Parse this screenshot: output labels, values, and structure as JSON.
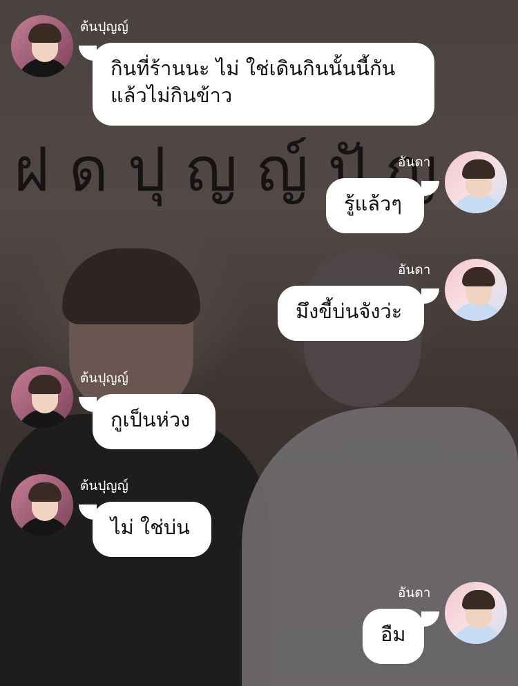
{
  "chat": {
    "sender_left": "ต้นปุญญ์",
    "sender_right": "อันดา",
    "banner_text": "ฝดปุญญ์ปัญ",
    "messages": [
      {
        "side": "left",
        "sender": "ต้นปุญญ์",
        "lines": [
          "กินที่ร้านนะ ไม่ ใช่เดินกินนั้นนี้กัน",
          "แล้วไม่กินข้าว"
        ]
      },
      {
        "side": "right",
        "sender": "อันดา",
        "lines": [
          "รู้แล้วๆ"
        ]
      },
      {
        "side": "right",
        "sender": "อันดา",
        "lines": [
          "มึงขี้บ่นจังว่ะ"
        ]
      },
      {
        "side": "left",
        "sender": "ต้นปุญญ์",
        "lines": [
          "กูเป็นห่วง"
        ]
      },
      {
        "side": "left",
        "sender": "ต้นปุญญ์",
        "lines": [
          "ไม่ ใช่บ่น"
        ]
      },
      {
        "side": "right",
        "sender": "อันดา",
        "lines": [
          "อืม"
        ]
      }
    ]
  },
  "colors": {
    "bubble": "#ffffff",
    "name_text": "#ffffff",
    "message_text": "#111111"
  }
}
